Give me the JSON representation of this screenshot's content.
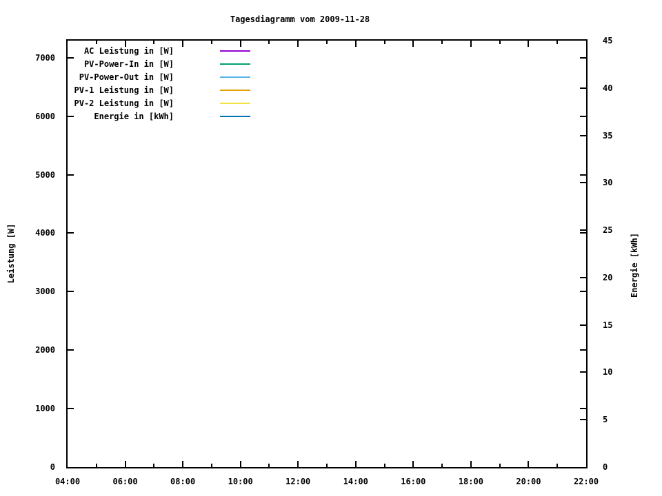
{
  "title": "Tagesdiagramm vom 2009-11-28",
  "chart_data": {
    "type": "line",
    "title": "Tagesdiagramm vom 2009-11-28",
    "plot_empty": true,
    "grid": false,
    "legend_position": "top-left-inside",
    "x_axis": {
      "label": "",
      "unit": "time",
      "range_hours": [
        4,
        22
      ],
      "major_tick_hours": [
        4,
        6,
        8,
        10,
        12,
        14,
        16,
        18,
        20,
        22
      ],
      "major_tick_labels": [
        "04:00",
        "06:00",
        "08:00",
        "10:00",
        "12:00",
        "14:00",
        "16:00",
        "18:00",
        "20:00",
        "22:00"
      ],
      "minor_tick_hours": [
        5,
        7,
        9,
        11,
        13,
        15,
        17,
        19,
        21
      ]
    },
    "y_left": {
      "label": "Leistung [W]",
      "range": [
        0,
        7293
      ],
      "major_ticks": [
        0,
        1000,
        2000,
        3000,
        4000,
        5000,
        6000,
        7000
      ],
      "major_tick_labels": [
        "0",
        "1000",
        "2000",
        "3000",
        "4000",
        "5000",
        "6000",
        "7000"
      ]
    },
    "y_right": {
      "label": "Energie [kWh]",
      "range": [
        0,
        45
      ],
      "major_ticks": [
        0,
        5,
        10,
        15,
        20,
        25,
        30,
        35,
        40,
        45
      ],
      "major_tick_labels": [
        "0",
        "5",
        "10",
        "15",
        "20",
        "25",
        "30",
        "35",
        "40",
        "45"
      ],
      "mirrors_left_major_ticks": true
    },
    "series": [
      {
        "name": "AC Leistung in [W]",
        "color": "#9400d3",
        "axis": "left",
        "values": []
      },
      {
        "name": "PV-Power-In in [W]",
        "color": "#009e73",
        "axis": "left",
        "values": []
      },
      {
        "name": "PV-Power-Out in [W]",
        "color": "#56b4e9",
        "axis": "left",
        "values": []
      },
      {
        "name": "PV-1 Leistung in [W]",
        "color": "#e69f00",
        "axis": "left",
        "values": []
      },
      {
        "name": "PV-2 Leistung in [W]",
        "color": "#f0e442",
        "axis": "left",
        "values": []
      },
      {
        "name": "Energie in [kWh]",
        "color": "#0072b2",
        "axis": "right",
        "values": []
      }
    ]
  }
}
